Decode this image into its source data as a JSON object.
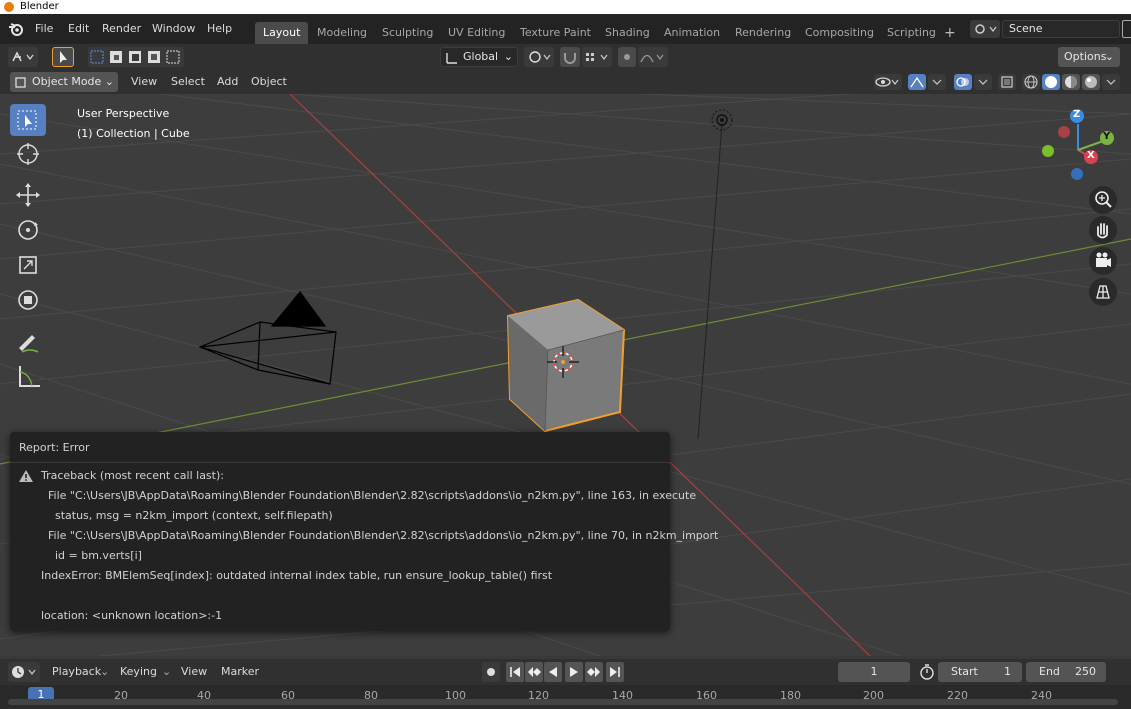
{
  "window": {
    "title": "Blender"
  },
  "topbar": {
    "menus": [
      "File",
      "Edit",
      "Render",
      "Window",
      "Help"
    ],
    "workspaces": [
      "Layout",
      "Modeling",
      "Sculpting",
      "UV Editing",
      "Texture Paint",
      "Shading",
      "Animation",
      "Rendering",
      "Compositing",
      "Scripting"
    ],
    "active_workspace": "Layout",
    "add_tab": "+",
    "scene": "Scene"
  },
  "tool_settings": {
    "transform_orientation": "Global",
    "options_label": "Options"
  },
  "header": {
    "mode": "Object Mode",
    "menus": [
      "View",
      "Select",
      "Add",
      "Object"
    ]
  },
  "viewport": {
    "perspective": "User Perspective",
    "collection_info": "(1) Collection | Cube",
    "gizmo_axes": {
      "x": "X",
      "y": "Y",
      "z": "Z"
    }
  },
  "report": {
    "title": "Report: Error",
    "lines": [
      "Traceback (most recent call last):",
      "  File \"C:\\Users\\JB\\AppData\\Roaming\\Blender Foundation\\Blender\\2.82\\scripts\\addons\\io_n2km.py\", line 163, in execute",
      "    status, msg = n2km_import (context, self.filepath)",
      "  File \"C:\\Users\\JB\\AppData\\Roaming\\Blender Foundation\\Blender\\2.82\\scripts\\addons\\io_n2km.py\", line 70, in n2km_import",
      "    id = bm.verts[i]",
      "IndexError: BMElemSeq[index]: outdated internal index table, run ensure_lookup_table() first",
      "",
      "location: <unknown location>:-1"
    ]
  },
  "timeline": {
    "menus": [
      "Playback",
      "Keying",
      "View",
      "Marker"
    ],
    "current_frame": "1",
    "start_label": "Start",
    "start_value": "1",
    "end_label": "End",
    "end_value": "250",
    "ruler_ticks": [
      "1",
      "20",
      "40",
      "60",
      "80",
      "100",
      "120",
      "140",
      "160",
      "180",
      "200",
      "220",
      "240"
    ]
  },
  "colors": {
    "accent": "#5680c2",
    "selection_outline": "#f0a030",
    "x_axis": "#d9434f",
    "y_axis": "#7cb342",
    "z_axis": "#3b8be0"
  }
}
